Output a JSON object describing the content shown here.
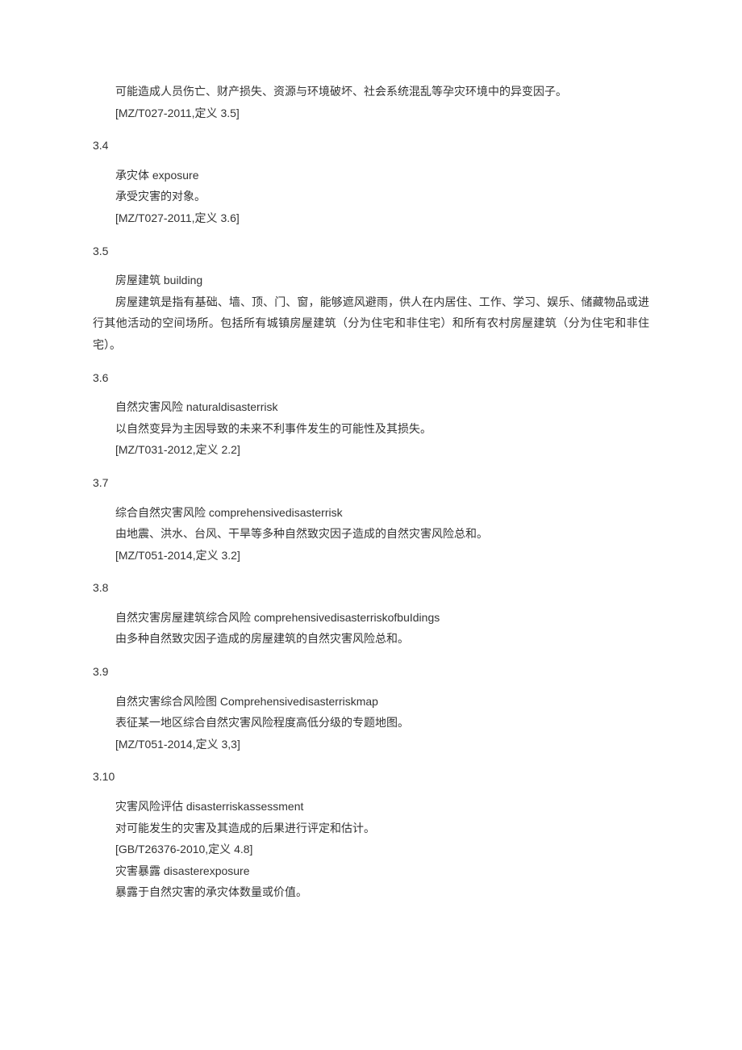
{
  "intro": {
    "line1": "可能造成人员伤亡、财产损失、资源与环境破坏、社会系统混乱等孕灾环境中的异变因子。",
    "ref": "[MZ/T027-2011,定义 3.5]"
  },
  "sections": [
    {
      "num": "3.4",
      "lines": [
        "承灾体 exposure",
        "承受灾害的对象。",
        "[MZ/T027-2011,定义 3.6]"
      ]
    },
    {
      "num": "3.5",
      "lines": [
        "房屋建筑 building"
      ],
      "para": "房屋建筑是指有基础、墙、顶、门、窗，能够遮风避雨，供人在内居住、工作、学习、娱乐、储藏物品或进行其他活动的空间场所。包括所有城镇房屋建筑（分为住宅和非住宅）和所有农村房屋建筑（分为住宅和非住宅）。"
    },
    {
      "num": "3.6",
      "lines": [
        "自然灾害风险 naturaldisasterrisk",
        "以自然变异为主因导致的未来不利事件发生的可能性及其损失。",
        "[MZ/T031-2012,定义 2.2]"
      ]
    },
    {
      "num": "3.7",
      "lines": [
        "综合自然灾害风险 comprehensivedisasterrisk",
        "由地震、洪水、台风、干旱等多种自然致灾因子造成的自然灾害风险总和。",
        "[MZ/T051-2014,定义 3.2]"
      ]
    },
    {
      "num": "3.8",
      "lines": [
        "自然灾害房屋建筑综合风险 comprehensivedisasterriskofbuIdings",
        "由多种自然致灾因子造成的房屋建筑的自然灾害风险总和。"
      ]
    },
    {
      "num": "3.9",
      "lines": [
        "自然灾害综合风险图 Comprehensivedisasterriskmap",
        "表征某一地区综合自然灾害风险程度高低分级的专题地图。",
        "[MZ/T051-2014,定义 3,3]"
      ]
    },
    {
      "num": "3.10",
      "lines": [
        "灾害风险评估 disasterriskassessment",
        "对可能发生的灾害及其造成的后果进行评定和估计。",
        "[GB/T26376-2010,定义 4.8]",
        "灾害暴露 disasterexposure",
        "暴露于自然灾害的承灾体数量或价值。"
      ]
    }
  ]
}
